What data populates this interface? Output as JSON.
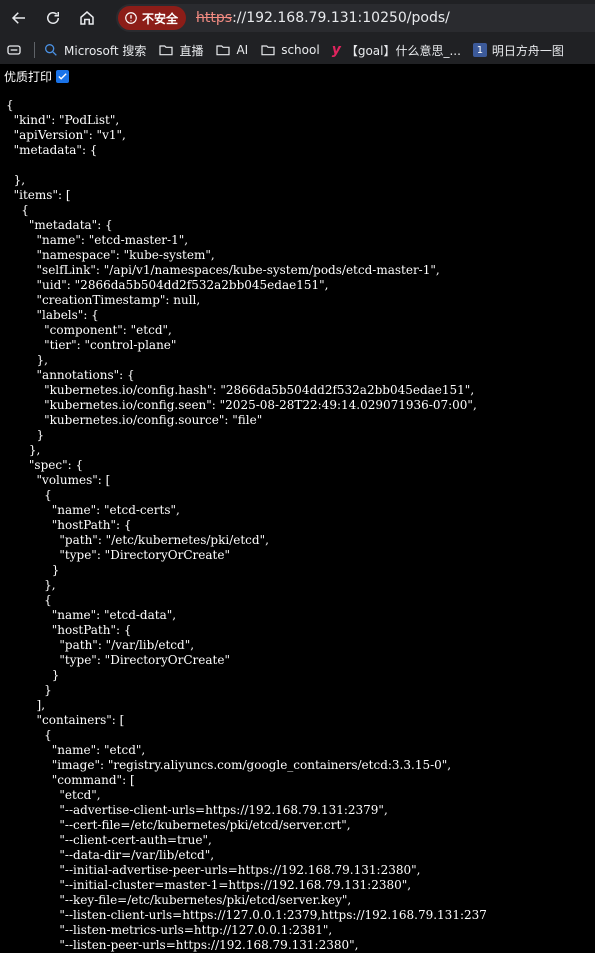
{
  "browser": {
    "security_chip": "不安全",
    "url_scheme": "https",
    "url_rest": "://192.168.79.131:10250/pods/"
  },
  "bookmarks": [
    {
      "icon": "search-icon",
      "label": "Microsoft 搜索"
    },
    {
      "icon": "folder-icon",
      "label": "直播"
    },
    {
      "icon": "folder-icon",
      "label": "AI"
    },
    {
      "icon": "folder-icon",
      "label": "school"
    },
    {
      "icon": "y-site-icon",
      "label": "【goal】什么意思_..."
    },
    {
      "icon": "number-one-icon",
      "label": "明日方舟一图"
    }
  ],
  "pretty_print": {
    "label": "优质打印",
    "checked": true
  },
  "json_lines": [
    "{",
    "  \"kind\": \"PodList\",",
    "  \"apiVersion\": \"v1\",",
    "  \"metadata\": {",
    "",
    "  },",
    "  \"items\": [",
    "    {",
    "      \"metadata\": {",
    "        \"name\": \"etcd-master-1\",",
    "        \"namespace\": \"kube-system\",",
    "        \"selfLink\": \"/api/v1/namespaces/kube-system/pods/etcd-master-1\",",
    "        \"uid\": \"2866da5b504dd2f532a2bb045edae151\",",
    "        \"creationTimestamp\": null,",
    "        \"labels\": {",
    "          \"component\": \"etcd\",",
    "          \"tier\": \"control-plane\"",
    "        },",
    "        \"annotations\": {",
    "          \"kubernetes.io/config.hash\": \"2866da5b504dd2f532a2bb045edae151\",",
    "          \"kubernetes.io/config.seen\": \"2025-08-28T22:49:14.029071936-07:00\",",
    "          \"kubernetes.io/config.source\": \"file\"",
    "        }",
    "      },",
    "      \"spec\": {",
    "        \"volumes\": [",
    "          {",
    "            \"name\": \"etcd-certs\",",
    "            \"hostPath\": {",
    "              \"path\": \"/etc/kubernetes/pki/etcd\",",
    "              \"type\": \"DirectoryOrCreate\"",
    "            }",
    "          },",
    "          {",
    "            \"name\": \"etcd-data\",",
    "            \"hostPath\": {",
    "              \"path\": \"/var/lib/etcd\",",
    "              \"type\": \"DirectoryOrCreate\"",
    "            }",
    "          }",
    "        ],",
    "        \"containers\": [",
    "          {",
    "            \"name\": \"etcd\",",
    "            \"image\": \"registry.aliyuncs.com/google_containers/etcd:3.3.15-0\",",
    "            \"command\": [",
    "              \"etcd\",",
    "              \"--advertise-client-urls=https://192.168.79.131:2379\",",
    "              \"--cert-file=/etc/kubernetes/pki/etcd/server.crt\",",
    "              \"--client-cert-auth=true\",",
    "              \"--data-dir=/var/lib/etcd\",",
    "              \"--initial-advertise-peer-urls=https://192.168.79.131:2380\",",
    "              \"--initial-cluster=master-1=https://192.168.79.131:2380\",",
    "              \"--key-file=/etc/kubernetes/pki/etcd/server.key\",",
    "              \"--listen-client-urls=https://127.0.0.1:2379,https://192.168.79.131:237",
    "              \"--listen-metrics-urls=http://127.0.0.1:2381\",",
    "              \"--listen-peer-urls=https://192.168.79.131:2380\","
  ]
}
